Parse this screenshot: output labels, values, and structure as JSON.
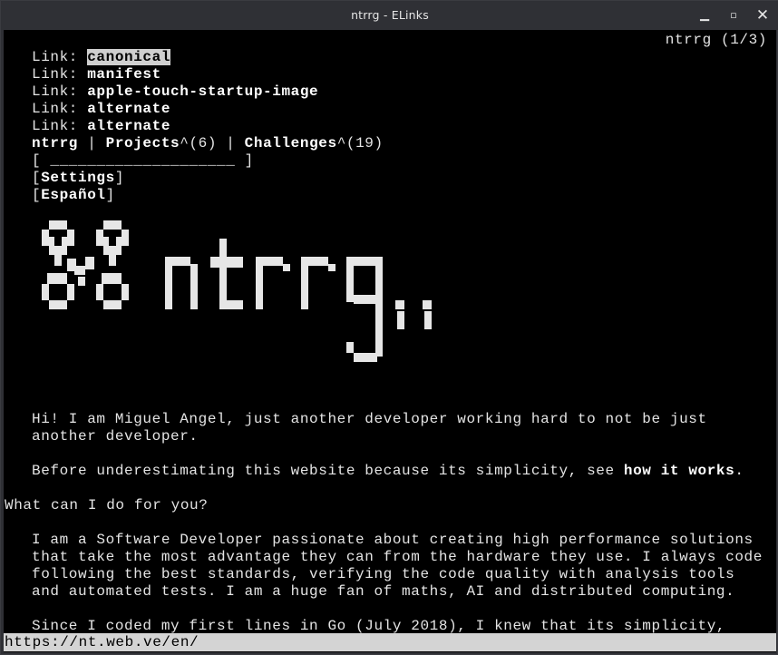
{
  "window": {
    "title": "ntrrg - ELinks"
  },
  "controls": {
    "minimize_glyph": "▁",
    "maximize_glyph": "▫",
    "close_glyph": "✕"
  },
  "status_top": "ntrrg (1/3)",
  "links": [
    {
      "prefix": "Link: ",
      "label": "canonical"
    },
    {
      "prefix": "Link: ",
      "label": "manifest"
    },
    {
      "prefix": "Link: ",
      "label": "apple-touch-startup-image"
    },
    {
      "prefix": "Link: ",
      "label": "alternate"
    },
    {
      "prefix": "Link: ",
      "label": "alternate"
    }
  ],
  "nav": {
    "home": "ntrrg",
    "sep": " | ",
    "projects": "Projects",
    "projects_count": "^(6)",
    "challenges": "Challenges",
    "challenges_count": "^(19)"
  },
  "search_field": "[ ____________________ ]",
  "settings": {
    "open": "[",
    "label": "Settings",
    "close": "]"
  },
  "language": {
    "open": "[",
    "label": "Español",
    "close": "]"
  },
  "logo": {
    "text": "ntrrg",
    "icon": "ntrrg-logo-icon"
  },
  "intro": {
    "line1": "Hi! I am Miguel Angel, just another developer working hard to not be just",
    "line2": "another developer.",
    "before_pre": "Before underestimating this website because its simplicity, see ",
    "before_link": "how it works",
    "before_post": "."
  },
  "section_heading": "What can I do for you?",
  "paragraph": [
    "I am a Software Developer passionate about creating high performance solutions",
    "that take the most advantage they can from the hardware they use. I always code",
    "following the best standards, verifying the code quality with analysis tools",
    "and automated tests. I am a huge fan of maths, AI and distributed computing."
  ],
  "last_line": "Since I coded my first lines in Go (July 2018), I knew that its simplicity,",
  "statusbar": "https://nt.web.ve/en/"
}
